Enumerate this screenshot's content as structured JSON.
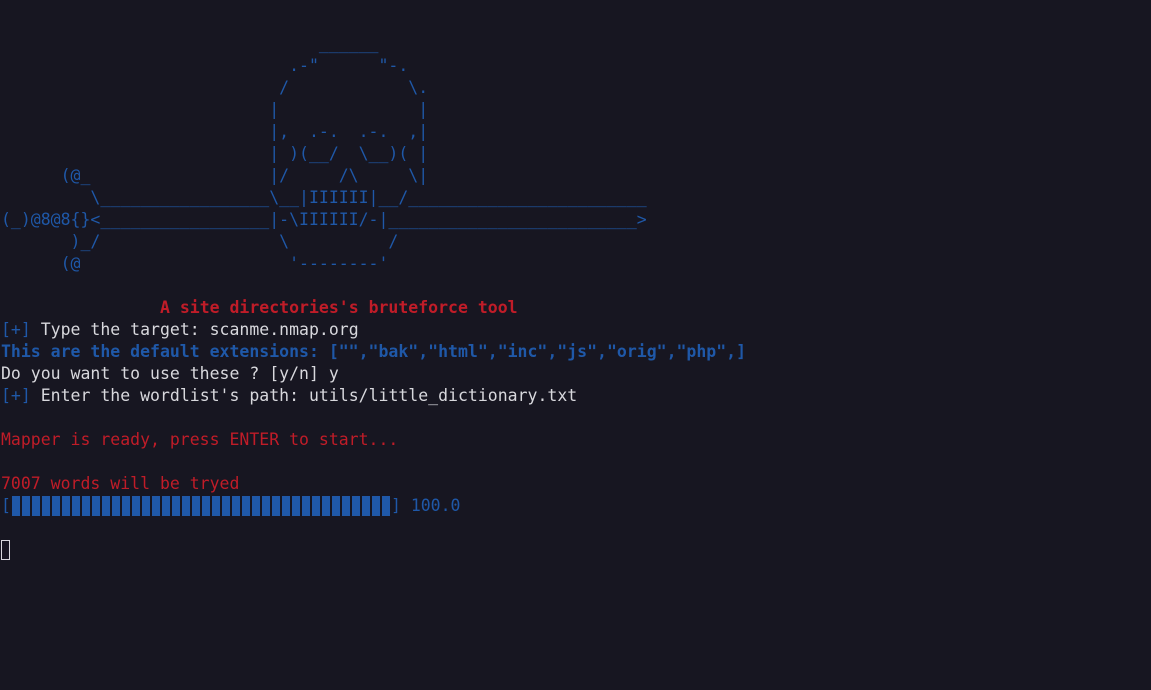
{
  "art": {
    "lines": [
      "                                ______",
      "                             .-\"      \"-.",
      "                            /            \\.",
      "                           |              |",
      "                           |,  .-.  .-.  ,|",
      "                           | )(__/  \\__)( |",
      "      (@_                  |/     /\\     \\|",
      " _     ) \\_________________(_     ^^     _)",
      "(_)@8@8{}<_________________|-\\IIIIII/-|_________________________>",
      "       )_/                  \\          /",
      "      (@                     '--------'"
    ],
    "overlay_line": "         \\_________________\\__|IIIIII|__/________________________"
  },
  "tagline": "A site directories's bruteforce tool",
  "prompts": {
    "target_prefix": "[+]",
    "target_label": " Type the target: ",
    "target_value": "scanme.nmap.org",
    "extensions_text": "This are the default extensions: [\"\",\"bak\",\"html\",\"inc\",\"js\",\"orig\",\"php\",]",
    "use_default_question": "Do you want to use these ? [y/n] ",
    "use_default_answer": "y",
    "wordlist_prefix": "[+]",
    "wordlist_label": " Enter the wordlist's path: ",
    "wordlist_value": "utils/little_dictionary.txt"
  },
  "ready_message": "Mapper is ready, press ENTER to start...",
  "words_message": "7007 words will be tryed",
  "progress": {
    "open_bracket": "[",
    "close_bracket": "]",
    "percent_text": "100.0",
    "fraction": 1.0
  },
  "colors": {
    "background": "#171621",
    "blue": "#1f58a8",
    "red": "#c01c28",
    "text": "#d8d8dd"
  }
}
